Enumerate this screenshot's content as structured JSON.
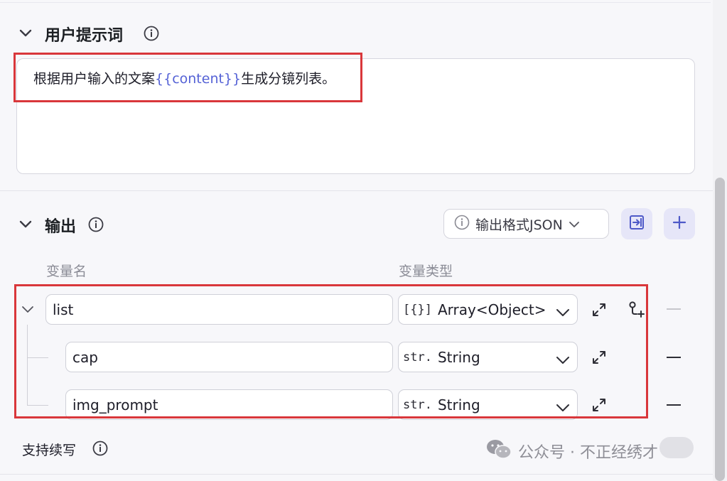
{
  "user_prompt": {
    "title": "用户提示词",
    "text_before": "根据用户输入的文案",
    "variable": "{{content}}",
    "text_after": "生成分镜列表。"
  },
  "output": {
    "title": "输出",
    "format_label": "输出格式JSON",
    "column_name": "变量名",
    "column_type": "变量类型",
    "rows": [
      {
        "name": "list",
        "type_tag": "[{}]",
        "type": "Array<Object>"
      },
      {
        "name": "cap",
        "type_tag": "str.",
        "type": "String"
      },
      {
        "name": "img_prompt",
        "type_tag": "str.",
        "type": "String"
      }
    ]
  },
  "continue_writing": {
    "label": "支持续写"
  },
  "watermark": {
    "text": "公众号 · 不正经绣才"
  },
  "colors": {
    "accent": "#5562d6",
    "highlight_border": "#d9373b",
    "button_bg": "#e6e6f8"
  },
  "icons": [
    "chevron-down-icon",
    "info-icon",
    "import-icon",
    "plus-icon",
    "expand-icon",
    "add-child-icon",
    "wechat-icon"
  ]
}
